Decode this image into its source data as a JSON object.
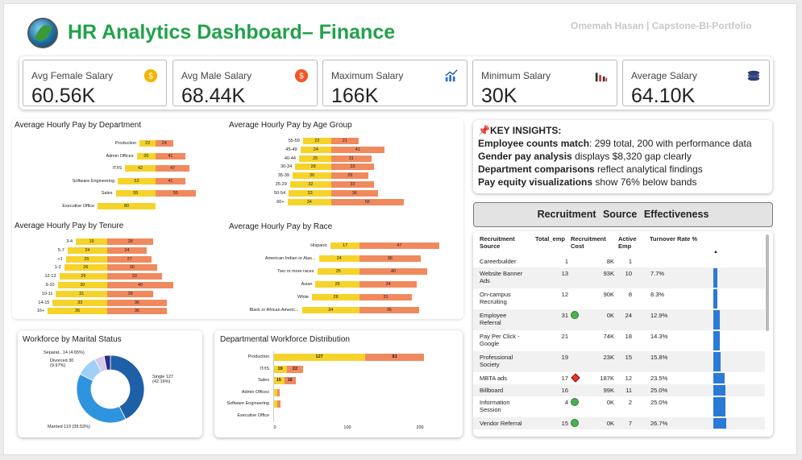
{
  "header": {
    "title": "HR Analytics Dashboard– Finance",
    "author": "Omemah Hasan | Capstone-BI-Portfolio"
  },
  "kpis": [
    {
      "label": "Avg Female Salary",
      "value": "60.56K",
      "icon": "coin-icon",
      "color": "#f4b400"
    },
    {
      "label": "Avg Male Salary",
      "value": "68.44K",
      "icon": "dollar-icon",
      "color": "#f05a22"
    },
    {
      "label": "Maximum Salary",
      "value": "166K",
      "icon": "trend-up-icon",
      "color": "#2a6fd6"
    },
    {
      "label": "Minimum Salary",
      "value": "30K",
      "icon": "bar-chart-icon",
      "color": "#d13434"
    },
    {
      "label": "Average Salary",
      "value": "64.10K",
      "icon": "coin-stack-icon",
      "color": "#2c3e70"
    }
  ],
  "insights": {
    "title": "📌KEY INSIGHTS:",
    "lines": [
      {
        "b": "Employee counts match",
        "t": ": 299 total, 200 with performance data"
      },
      {
        "b": "Gender pay analysis",
        "t": " displays $8,320 gap clearly"
      },
      {
        "b": "Department comparisons",
        "t": " reflect analytical findings"
      },
      {
        "b": "Pay equity visualizations",
        "t": " show 76% below bands"
      }
    ]
  },
  "recruitment": {
    "title": "Recruitment Source Effectiveness",
    "headers": [
      "Recruitment Source",
      "Total_emp",
      "Recruitment Cost",
      "Active Emp",
      "Turnover Rate %"
    ],
    "rows": [
      {
        "source": "Careerbuilder",
        "total": "1",
        "cost": "8K",
        "active": "1",
        "rate": "",
        "rate_v": 0,
        "flag": ""
      },
      {
        "source": "Website Banner Ads",
        "total": "13",
        "cost": "93K",
        "active": "10",
        "rate": "7.7%",
        "rate_v": 7.7,
        "flag": ""
      },
      {
        "source": "On-campus Recruiting",
        "total": "12",
        "cost": "90K",
        "active": "8",
        "rate": "8.3%",
        "rate_v": 8.3,
        "flag": ""
      },
      {
        "source": "Employee Referral",
        "total": "31",
        "cost": "0K",
        "active": "24",
        "rate": "12.9%",
        "rate_v": 12.9,
        "flag": "green"
      },
      {
        "source": "Pay Per Click - Google",
        "total": "21",
        "cost": "74K",
        "active": "18",
        "rate": "14.3%",
        "rate_v": 14.3,
        "flag": ""
      },
      {
        "source": "Professional Society",
        "total": "19",
        "cost": "23K",
        "active": "15",
        "rate": "15.8%",
        "rate_v": 15.8,
        "flag": ""
      },
      {
        "source": "MBTA ads",
        "total": "17",
        "cost": "187K",
        "active": "12",
        "rate": "23.5%",
        "rate_v": 23.5,
        "flag": "red"
      },
      {
        "source": "Billboard",
        "total": "16",
        "cost": "99K",
        "active": "11",
        "rate": "25.0%",
        "rate_v": 25.0,
        "flag": ""
      },
      {
        "source": "Information Session",
        "total": "4",
        "cost": "0K",
        "active": "2",
        "rate": "25.0%",
        "rate_v": 25.0,
        "flag": "green"
      },
      {
        "source": "Vendor Referral",
        "total": "15",
        "cost": "0K",
        "active": "7",
        "rate": "26.7%",
        "rate_v": 26.7,
        "flag": "green"
      }
    ]
  },
  "chart_data": [
    {
      "type": "bar",
      "title": "Average Hourly Pay by Department",
      "categories": [
        "Production",
        "Admin Offices",
        "IT/IS",
        "Software Engineering",
        "Sales",
        "Executive Office"
      ],
      "series": [
        {
          "values": [
            22,
            26,
            42,
            52,
            55,
            80
          ],
          "color": "#f6d32a"
        },
        {
          "values": [
            24,
            41,
            47,
            41,
            55,
            null
          ],
          "color": "#f08a5e"
        }
      ]
    },
    {
      "type": "bar",
      "title": "Average Hourly Pay by Age Group",
      "categories": [
        "55-59",
        "45-49",
        "40-44",
        "30-34",
        "35-39",
        "25-29",
        "50-54",
        "60+"
      ],
      "series": [
        {
          "values": [
            22,
            24,
            25,
            28,
            30,
            32,
            33,
            34
          ],
          "color": "#f6d32a"
        },
        {
          "values": [
            21,
            41,
            31,
            33,
            29,
            33,
            36,
            56
          ],
          "color": "#f08a5e"
        }
      ]
    },
    {
      "type": "bar",
      "title": "Average Hourly Pay by Tenure",
      "categories": [
        "3-4",
        "5-7",
        "<1",
        "1-2",
        "12-13",
        "9-10",
        "10-11",
        "14-15",
        "16+"
      ],
      "series": [
        {
          "values": [
            19,
            24,
            25,
            26,
            29,
            30,
            31,
            33,
            36
          ],
          "color": "#f6d32a"
        },
        {
          "values": [
            28,
            24,
            27,
            30,
            33,
            40,
            28,
            36,
            36
          ],
          "color": "#f08a5e"
        }
      ]
    },
    {
      "type": "bar",
      "title": "Average Hourly Pay by Race",
      "categories": [
        "Hispanic",
        "American Indian or Alas...",
        "Two or more races",
        "Asian",
        "White",
        "Black or African Americ..."
      ],
      "series": [
        {
          "values": [
            17,
            24,
            25,
            26,
            28,
            34
          ],
          "color": "#f6d32a"
        },
        {
          "values": [
            47,
            36,
            40,
            34,
            31,
            35
          ],
          "color": "#f08a5e"
        }
      ]
    },
    {
      "type": "pie",
      "title": "Workforce by Marital Status",
      "categories": [
        "Single",
        "Married",
        "Divorced",
        "Separat..",
        "Widowed"
      ],
      "values": [
        127,
        119,
        30,
        14,
        9
      ],
      "labels": [
        "Single 127 (42.19%)",
        "Married 119 (39.53%)",
        "Divorced 30 (9.97%)",
        "Separat.. 14 (4.65%)"
      ],
      "colors": [
        "#1f5fa8",
        "#2f94e0",
        "#9fd0f5",
        "#d5c9ee",
        "#2a2a88"
      ]
    },
    {
      "type": "bar",
      "title": "Departmental Workforce Distribution",
      "categories": [
        "Production",
        "IT/IS",
        "Sales",
        "Admin Offices",
        "Software Engineering",
        "Executive Office"
      ],
      "series": [
        {
          "values": [
            127,
            19,
            15,
            6,
            5,
            1
          ],
          "color": "#f6d32a"
        },
        {
          "values": [
            81,
            22,
            16,
            3,
            5,
            0
          ],
          "color": "#f08a5e"
        }
      ],
      "xticks": [
        "0",
        "100",
        "200"
      ],
      "xlim": [
        0,
        220
      ]
    }
  ]
}
